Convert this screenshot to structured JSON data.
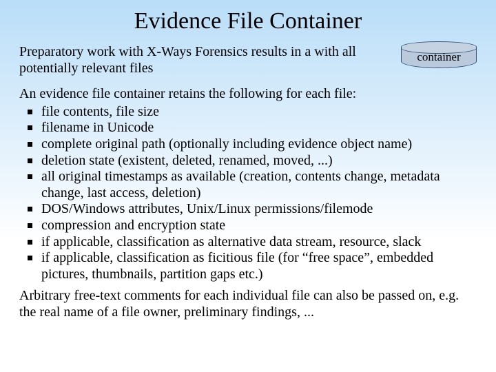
{
  "title": "Evidence File Container",
  "intro": "Preparatory work with X-Ways Forensics results in a with all potentially relevant files",
  "cylinder_label": "container",
  "list_lead": "An evidence file container retains the following for each file:",
  "properties": [
    "file contents, file size",
    "filename in Unicode",
    "complete original path (optionally including evidence object name)",
    "deletion state (existent, deleted, renamed, moved, ...)",
    "all original timestamps as available (creation, contents change, metadata change, last access, deletion)",
    "DOS/Windows attributes, Unix/Linux permissions/filemode",
    "compression and encryption state",
    "if applicable, classification as alternative data stream, resource, slack",
    "if applicable, classification as ficitious file (for “free space”, embedded pictures, thumbnails, partition gaps etc.)"
  ],
  "footer": "Arbitrary free-text comments for each individual file can also be passed on, e.g. the real name of a file owner, preliminary findings, ..."
}
